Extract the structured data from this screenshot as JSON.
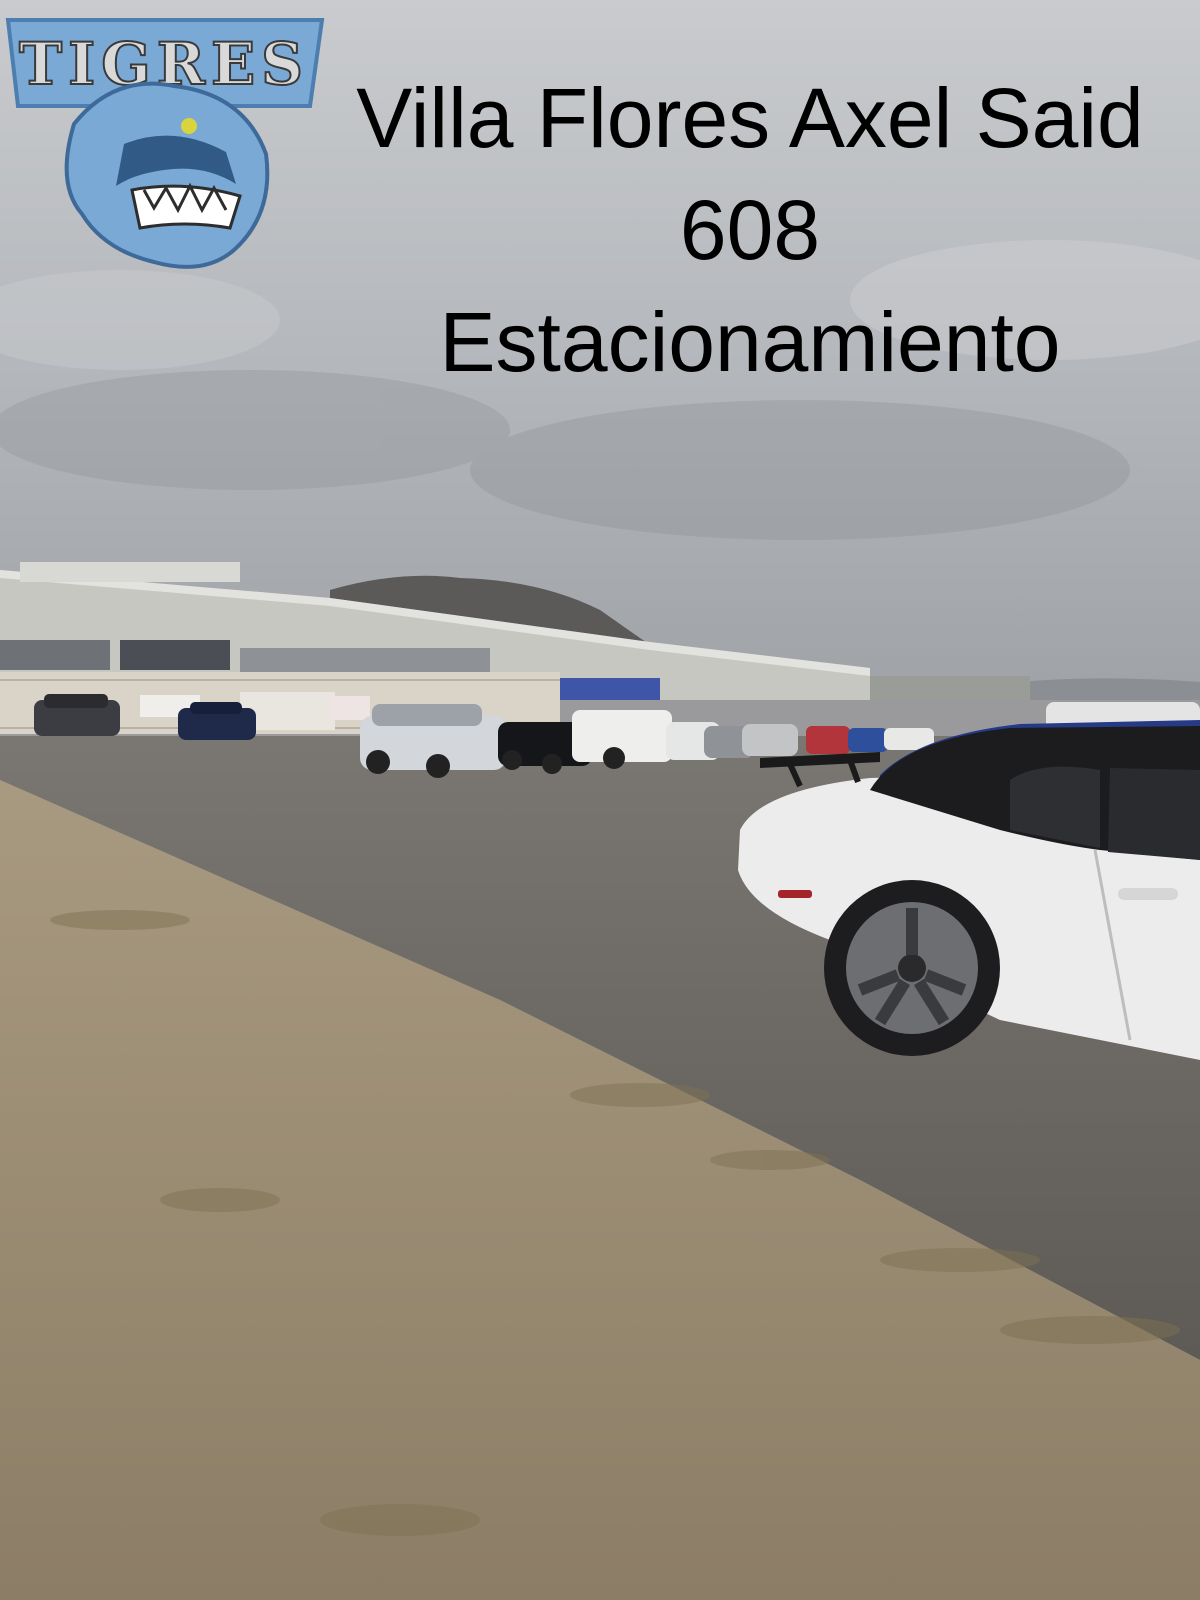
{
  "logo": {
    "text": "TIGRES",
    "name": "tigres-logo"
  },
  "caption": {
    "line1": "Villa Flores Axel Said",
    "line2": "608",
    "line3": "Estacionamiento"
  },
  "colors": {
    "sky_top": "#c9cbce",
    "sky_bottom": "#9fa2a6",
    "gravel": "#6f6b66",
    "dirt": "#a8987c",
    "logo_blue": "#6fa6d6",
    "caption": "#000000"
  }
}
